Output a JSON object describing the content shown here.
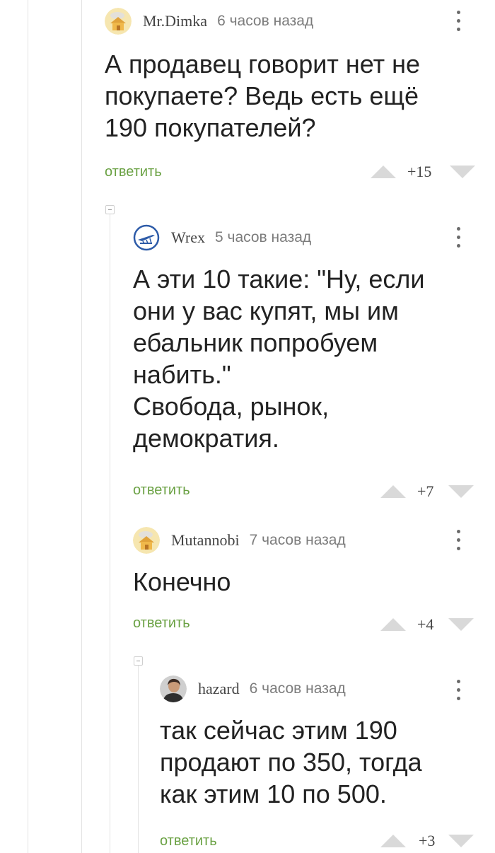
{
  "comments": [
    {
      "username": "Mr.Dimka",
      "time": "6 часов назад",
      "text": "А продавец говорит нет не\nпокупаете? Ведь есть ещё\n190 покупателей?",
      "reply": "ответить",
      "rating": "+15",
      "avatar_icon": "home-avatar-icon"
    },
    {
      "username": "Wrex",
      "time": "5 часов назад",
      "text": "А эти 10 такие: \"Ну, если\nони у вас купят, мы им\nебальник попробуем\nнабить.\"\nСвобода, рынок,\nдемократия.",
      "reply": "ответить",
      "rating": "+7",
      "avatar_icon": "aircraft-emblem-avatar-icon"
    },
    {
      "username": "Mutannobi",
      "time": "7 часов назад",
      "text": "Конечно",
      "reply": "ответить",
      "rating": "+4",
      "avatar_icon": "home-avatar-icon"
    },
    {
      "username": "hazard",
      "time": "6 часов назад",
      "text": "так сейчас этим 190\nпродают по 350, тогда\nкак этим 10 по 500.",
      "reply": "ответить",
      "rating": "+3",
      "avatar_icon": "person-photo-avatar-icon"
    }
  ],
  "colors": {
    "reply_link": "#6aa143",
    "vote_arrow": "#d9d9d9",
    "thread_line": "#e3e3e3"
  }
}
